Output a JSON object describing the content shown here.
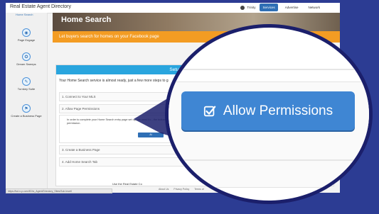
{
  "app": {
    "title": "Real Estate Agent Directory"
  },
  "nav": {
    "user": "Trinity",
    "items": [
      "Services",
      "Advertise",
      "Network"
    ],
    "active": "Services"
  },
  "sidebar": {
    "home_sub": "Home Search",
    "items": [
      {
        "label": "Page Engage",
        "icon": "target-icon"
      },
      {
        "label": "Dream Sweeps",
        "icon": "badge-icon"
      },
      {
        "label": "Turnkey Suite",
        "icon": "wrench-icon"
      },
      {
        "label": "Create a Business Page",
        "icon": "flag-icon"
      }
    ]
  },
  "hero": {
    "title": "Home Search"
  },
  "banner": {
    "text": "Let buyers search for homes on your Facebook page"
  },
  "panel": {
    "header": "Setup IDX Home Search",
    "intro": "Your Home Search service is almost ready, just a few more steps to g",
    "steps": [
      "1. Connect to Your MLS",
      "2. Allow Page Permissions",
      "3. Create a Business Page",
      "4. Add Home Search Tab"
    ],
    "step2_text": "In order to complete your Home Search entry page set up, we need th... the button below to grant us this permission.",
    "small_button": "Al"
  },
  "footer": {
    "line1": "Use the Real Estate Co",
    "brand": "Join Agent Directory",
    "brand_suffix": "N-Flex © 2015",
    "links": [
      "About Us",
      "Privacy Policy",
      "Terms of"
    ]
  },
  "status": {
    "url": "https://lsd.n-p.com/IDXa_Agent/Directory_Sites/Sub.Insetl"
  },
  "magnifier": {
    "button_label": "Allow Permissions",
    "button_icon": "checkbox-icon"
  },
  "colors": {
    "background": "#2c3c93",
    "accent": "#3f86d3",
    "orange": "#f39c23",
    "header_blue": "#29a5de"
  }
}
